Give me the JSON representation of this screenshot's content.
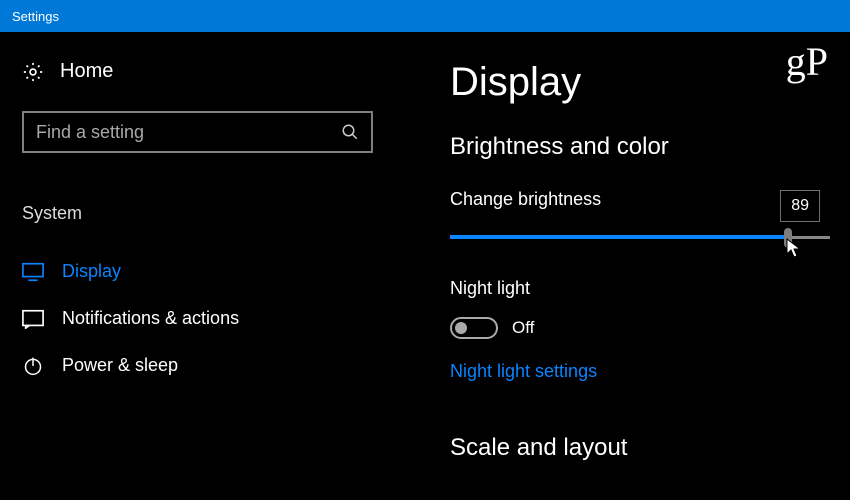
{
  "titlebar": {
    "title": "Settings"
  },
  "sidebar": {
    "home_label": "Home",
    "search_placeholder": "Find a setting",
    "category": "System",
    "items": [
      {
        "label": "Display",
        "active": true
      },
      {
        "label": "Notifications & actions",
        "active": false
      },
      {
        "label": "Power & sleep",
        "active": false
      }
    ]
  },
  "main": {
    "page_title": "Display",
    "section_brightness": "Brightness and color",
    "brightness_label": "Change brightness",
    "brightness_value": "89",
    "night_light_label": "Night light",
    "night_light_state": "Off",
    "night_light_settings": "Night light settings",
    "section_scale": "Scale and layout"
  },
  "watermark": "gP"
}
